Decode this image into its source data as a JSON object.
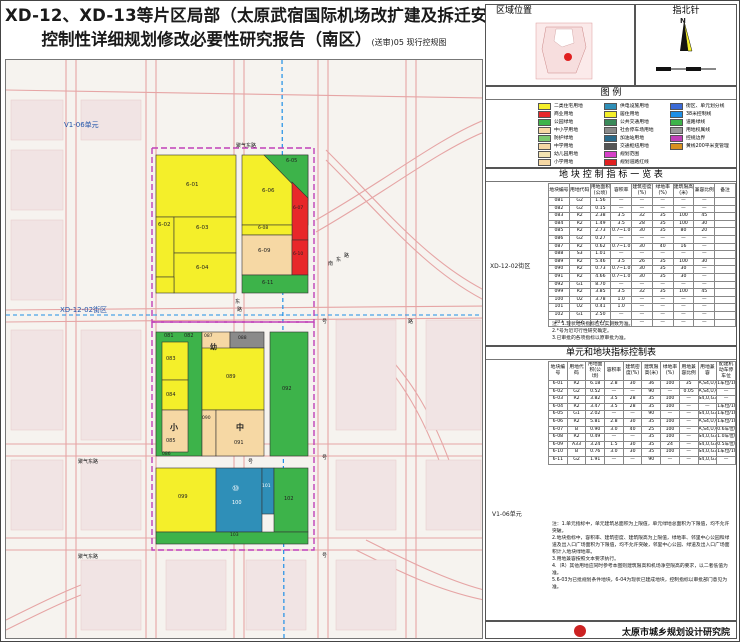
{
  "title": {
    "line1": "XD-12、XD-13等片区局部（太原武宿国际机场改扩建及拆迁安置地块）",
    "line2": "控制性详细规划修改必要性研究报告（南区）",
    "line2_sub": "(送审)05 现行控规图"
  },
  "panels": {
    "location": "区域位置",
    "north": "指北针",
    "north_letter": "N",
    "legend": "图 例",
    "indicator_table": "地 块 控 制 指 标 一 览 表",
    "unit_table": "单元和地块指标控制表"
  },
  "map_labels": {
    "v1_06": "V1-06单元",
    "xd_12_02": "XD-12-02街区",
    "road_e": "东",
    "road_lu": "路",
    "road_north": "聚气东路",
    "road_north_lbl": "聚气东路",
    "road_south": "聚气东路",
    "road_hao1": "号",
    "road_hao2": "号",
    "road_hao3": "号",
    "road_hao4": "号",
    "road_diag": "路",
    "road_diag2": "南",
    "road_diag3": "东",
    "road_diag4": "路"
  },
  "parcels": {
    "p6_01": "6-01",
    "p6_02": "6-02",
    "p6_03": "6-03",
    "p6_04": "6-04",
    "p6_05": "6-05",
    "p6_06": "6-06",
    "p6_07": "6-07",
    "p6_08": "6-08",
    "p6_09": "6-09",
    "p6_10": "6-10",
    "p6_11": "6-11",
    "p081": "081",
    "p082": "082",
    "p083": "083",
    "p084": "084",
    "p085": "085",
    "p086": "086",
    "p087": "087",
    "p088": "088",
    "p089": "089",
    "p090": "090",
    "p091": "091",
    "p092": "092",
    "p099": "099",
    "p100": "100",
    "p101": "101",
    "p102": "102",
    "p103": "103",
    "school_small": "小",
    "school_mid": "中",
    "school_kg": "幼",
    "symbol_110": "⑩"
  },
  "legend_items": [
    {
      "label": "二类住宅用地",
      "color": "#f4ef2a"
    },
    {
      "label": "商业用地",
      "color": "#e8272a"
    },
    {
      "label": "公园绿地",
      "color": "#3db34a"
    },
    {
      "label": "中小学用地",
      "color": "#f6d8a4"
    },
    {
      "label": "防护绿地",
      "color": "#7bc96f"
    },
    {
      "label": "中学用地",
      "color": "#f6d8a4"
    },
    {
      "label": "幼儿园用地",
      "color": "#f3e3b2"
    },
    {
      "label": "小学用地",
      "color": "#f6d8a4"
    },
    {
      "label": "供电设施用地",
      "color": "#2f8fb8"
    },
    {
      "label": "居住用地",
      "color": "#f4ef2a"
    },
    {
      "label": "公共交通用地",
      "color": "#3a8a5a"
    },
    {
      "label": "社会停车场用地",
      "color": "#8a8a8a"
    },
    {
      "label": "加油站用地",
      "color": "#2a6a8a"
    },
    {
      "label": "交通枢纽用地",
      "color": "#555"
    },
    {
      "label": "规划范围",
      "color": "#d640c8"
    },
    {
      "label": "规划道路红线",
      "color": "#e02020"
    },
    {
      "label": "街区、单元划分线",
      "color": "#3b6ad6"
    },
    {
      "label": "38米控制线",
      "color": "#1e8fe6"
    },
    {
      "label": "道路绿线",
      "color": "#3db34a"
    },
    {
      "label": "用地权属线",
      "color": "#999"
    },
    {
      "label": "控规边界",
      "color": "#c040b8"
    },
    {
      "label": "黄线200平米变管理",
      "color": "#d89020"
    }
  ],
  "indicator_headers": [
    "地块编号",
    "用地代码",
    "用地面积(公顷)",
    "容积率",
    "建筑密度(%)",
    "绿地率(%)",
    "建筑限高(米)",
    "兼容比例",
    "备注"
  ],
  "indicator_rows": [
    [
      "081",
      "G2",
      "1.56",
      "—",
      "—",
      "—",
      "—",
      "—",
      ""
    ],
    [
      "082",
      "G2",
      "0.15",
      "—",
      "—",
      "—",
      "—",
      "—",
      ""
    ],
    [
      "083",
      "R2",
      "2.38",
      "3.5",
      "32",
      "35",
      "100",
      "45",
      ""
    ],
    [
      "084",
      "R2",
      "1.49",
      "3.5",
      "28",
      "35",
      "100",
      "30",
      ""
    ],
    [
      "085",
      "R2",
      "2.73",
      "0.7~1.0",
      "30",
      "35",
      "80",
      "20",
      ""
    ],
    [
      "086",
      "G2",
      "0.27",
      "—",
      "—",
      "—",
      "—",
      "—",
      ""
    ],
    [
      "087",
      "R2",
      "0.62",
      "0.7~1.0",
      "30",
      "40",
      "16",
      "—",
      ""
    ],
    [
      "088",
      "S3",
      "1.01",
      "—",
      "—",
      "—",
      "—",
      "—",
      ""
    ],
    [
      "089",
      "R2",
      "5.46",
      "3.5",
      "26",
      "35",
      "100",
      "30",
      ""
    ],
    [
      "090",
      "R2",
      "0.73",
      "0.7~1.0",
      "30",
      "35",
      "30",
      "—",
      ""
    ],
    [
      "091",
      "R2",
      "4.66",
      "0.7~1.0",
      "30",
      "35",
      "30",
      "—",
      ""
    ],
    [
      "092",
      "G1",
      "8.70",
      "—",
      "—",
      "—",
      "—",
      "—",
      ""
    ],
    [
      "099",
      "R2",
      "3.85",
      "3.5",
      "32",
      "35",
      "100",
      "45",
      ""
    ],
    [
      "100",
      "U2",
      "3.78",
      "1.0",
      "—",
      "—",
      "—",
      "—",
      ""
    ],
    [
      "101",
      "U2",
      "0.41",
      "1.0",
      "—",
      "—",
      "—",
      "—",
      ""
    ],
    [
      "102",
      "G1",
      "2.50",
      "—",
      "—",
      "—",
      "—",
      "—",
      ""
    ],
    [
      "103",
      "G2",
      "2.27",
      "—",
      "—",
      "—",
      "—",
      "—",
      ""
    ]
  ],
  "indicator_side": "XD-12-02街区",
  "indicator_notes": [
    "注：1.现状地块指标应以实测数为准。",
    "2.*号为近可行性研究确定。",
    "3.已审批的各项指标以原审批为准。"
  ],
  "unit_headers": [
    "地块编号",
    "用地代码",
    "用地面积(公顷)",
    "容积率",
    "建筑密度(%)",
    "建筑限高(米)",
    "绿地率(%)",
    "用地兼容比例",
    "用地兼容",
    "配建机动车停车位"
  ],
  "unit_rows": [
    [
      "6-01",
      "R2",
      "6.18",
      "2.8",
      "30",
      "36",
      "100",
      "35",
      "A,S4,U,G",
      "1车位/100m²建筑面积"
    ],
    [
      "6-02",
      "G2",
      "0.52",
      "—",
      "—",
      "90",
      "—",
      "0.05",
      "A,S4,U,G",
      "—"
    ],
    [
      "6-03",
      "R2",
      "3.82",
      "3.5",
      "28",
      "35",
      "100",
      "—",
      "S4,U,G3",
      "—"
    ],
    [
      "6-04",
      "R2",
      "3.47",
      "3.5",
      "28",
      "35",
      "100",
      "—",
      "—",
      "1车位/100m²"
    ],
    [
      "6-05",
      "G1",
      "2.02",
      "—",
      "—",
      "90",
      "—",
      "—",
      "S4,U,G3",
      "1车位/100m²建筑面积"
    ],
    [
      "6-06",
      "R2",
      "5.81",
      "2.8",
      "30",
      "35",
      "100",
      "—",
      "A,S4,U,G",
      "1车位/100m²建筑面积"
    ],
    [
      "6-07",
      "B",
      "0.90",
      "3.0",
      "40",
      "25",
      "100",
      "—",
      "A,S4,U,G",
      "0.6车位/100m²"
    ],
    [
      "6-08",
      "R2",
      "0.49",
      "—",
      "—",
      "35",
      "100",
      "—",
      "S4,U,G3",
      "1.0车位/100m²"
    ],
    [
      "6-09",
      "A33",
      "3.24",
      "1.5",
      "30",
      "35",
      "24",
      "—",
      "S4,U,G3",
      "0.5车位/100m²"
    ],
    [
      "6-10",
      "B",
      "0.76",
      "3.0",
      "30",
      "35",
      "100",
      "—",
      "S4,U,G3",
      "1车位/100m²建筑面积"
    ],
    [
      "6-11",
      "G2",
      "1.91",
      "—",
      "—",
      "90",
      "—",
      "—",
      "S4,U,G3",
      "—"
    ]
  ],
  "unit_side": "V1-06单元",
  "unit_notes": [
    "注：1.单元指标中，单元建筑总面积为上限值，单元绿地总面积为下限值，均不允许突破。",
    "2.地块指标中，容积率、建筑密度、建筑限高为上限值，绿地率、邻里中心公园和绿道及出入口广场面积为下限值，均不允许突破，邻里中心公园、绿道及出入口广场面积计入地块绿地率。",
    "3.用地兼容按照文本要求执行。",
    "4.（R）其他用地应同时参考本图则建筑限高和机场净空限高的要求，以二者低值为准。",
    "5.6-03为已批规划条件地块，6-04为现状已建成地块，控制指标以审批部门意见为准。"
  ],
  "footer": "太原市城乡规划设计研究院"
}
